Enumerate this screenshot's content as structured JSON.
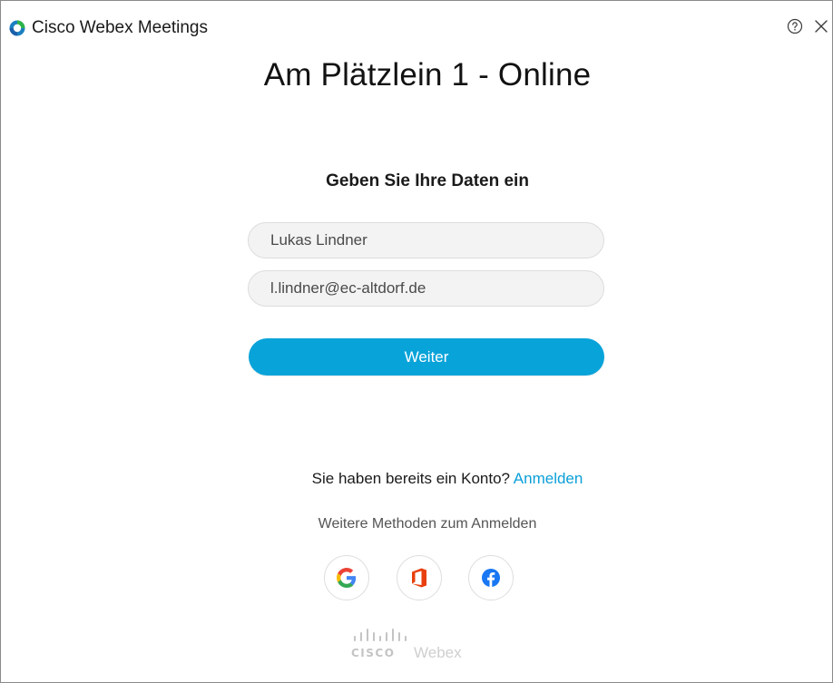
{
  "window": {
    "app_name": "Cisco Webex Meetings",
    "help_icon": "help-circle-icon",
    "close_icon": "close-icon"
  },
  "meeting": {
    "title": "Am Plätzlein 1 - Online"
  },
  "form": {
    "heading": "Geben Sie Ihre Daten ein",
    "name_value": "Lukas Lindner",
    "email_value": "l.lindner@ec-altdorf.de",
    "continue_label": "Weiter"
  },
  "signin": {
    "prompt": "Sie haben bereits ein Konto?",
    "link_label": "Anmelden",
    "more_methods": "Weitere Methoden zum Anmelden",
    "providers": [
      "google-icon",
      "office-icon",
      "facebook-icon"
    ]
  },
  "footer": {
    "cisco_label": "CISCO",
    "webex_label": "Webex"
  },
  "colors": {
    "accent": "#08a3d9",
    "link": "#0b9fd8"
  }
}
